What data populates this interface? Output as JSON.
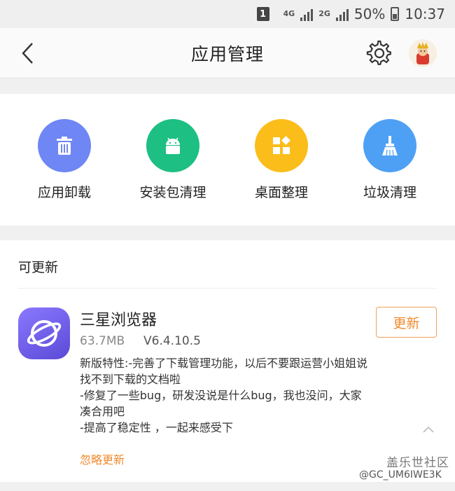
{
  "status_bar": {
    "notification_badge": "1",
    "network_4g": "4G",
    "network_2g": "2G",
    "battery_percent": "50%",
    "time": "10:37"
  },
  "header": {
    "title": "应用管理",
    "back_icon": "back-arrow-icon",
    "settings_icon": "gear-icon",
    "avatar_icon": "avatar"
  },
  "tools": [
    {
      "label": "应用卸载",
      "icon": "trash-icon",
      "color": "#6f86f5"
    },
    {
      "label": "安装包清理",
      "icon": "android-icon",
      "color": "#1dbf82"
    },
    {
      "label": "桌面整理",
      "icon": "grid-icon",
      "color": "#fbbd1a"
    },
    {
      "label": "垃圾清理",
      "icon": "broom-icon",
      "color": "#4ea0f5"
    }
  ],
  "updates": {
    "section_title": "可更新",
    "app": {
      "name": "三星浏览器",
      "size": "63.7MB",
      "version": "V6.4.10.5",
      "update_button": "更新",
      "notes": [
        "新版特性:-完善了下载管理功能，以后不要跟运营小姐姐说",
        "找不到下载的文档啦",
        "-修复了一些bug，研发没说是什么bug，我也没问，大家",
        "凑合用吧",
        "-提高了稳定性 ，一起来感受下"
      ],
      "ignore_link": "忽略更新",
      "icon_color": "#7564f0"
    }
  },
  "watermark": {
    "line1": "盖乐世社区",
    "line2": "@GC_UM6IWE3K"
  }
}
